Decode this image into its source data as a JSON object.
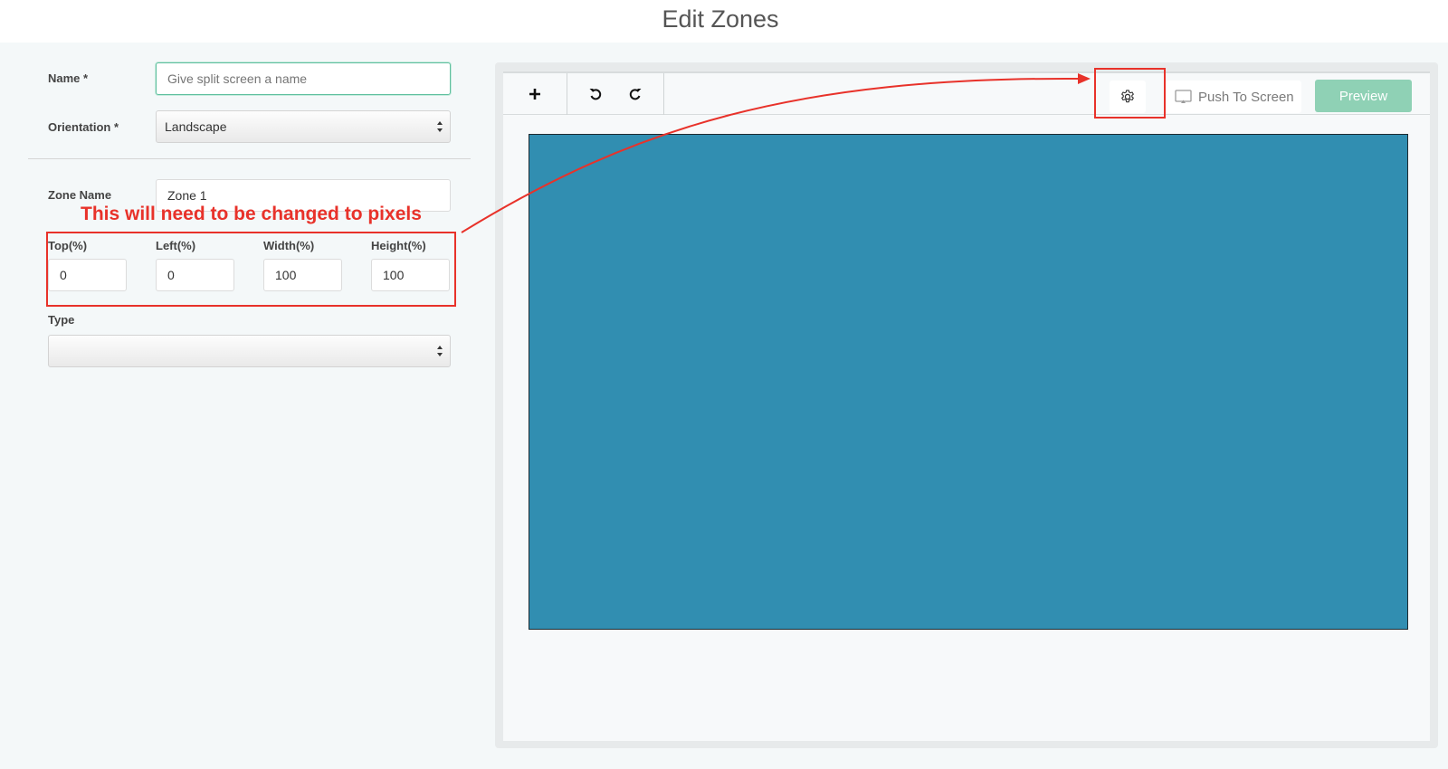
{
  "header": {
    "title": "Edit Zones"
  },
  "form": {
    "name_label": "Name *",
    "name_placeholder": "Give split screen a name",
    "orientation_label": "Orientation *",
    "orientation_value": "Landscape",
    "zone_name_label": "Zone Name",
    "zone_name_value": "Zone 1",
    "top_label": "Top(%)",
    "top_value": "0",
    "left_label": "Left(%)",
    "left_value": "0",
    "width_label": "Width(%)",
    "width_value": "100",
    "height_label": "Height(%)",
    "height_value": "100",
    "type_label": "Type",
    "type_value": ""
  },
  "annotation": {
    "text": "This will need to be changed to pixels",
    "color": "#e8322a"
  },
  "toolbar": {
    "add_icon": "plus-icon",
    "undo_icon": "undo-icon",
    "redo_icon": "redo-icon",
    "settings_icon": "gear-icon",
    "push_label": "Push To Screen",
    "preview_label": "Preview"
  },
  "colors": {
    "zone_fill": "#318eb1",
    "accent": "#8fd1b5",
    "annotation": "#e8322a"
  }
}
